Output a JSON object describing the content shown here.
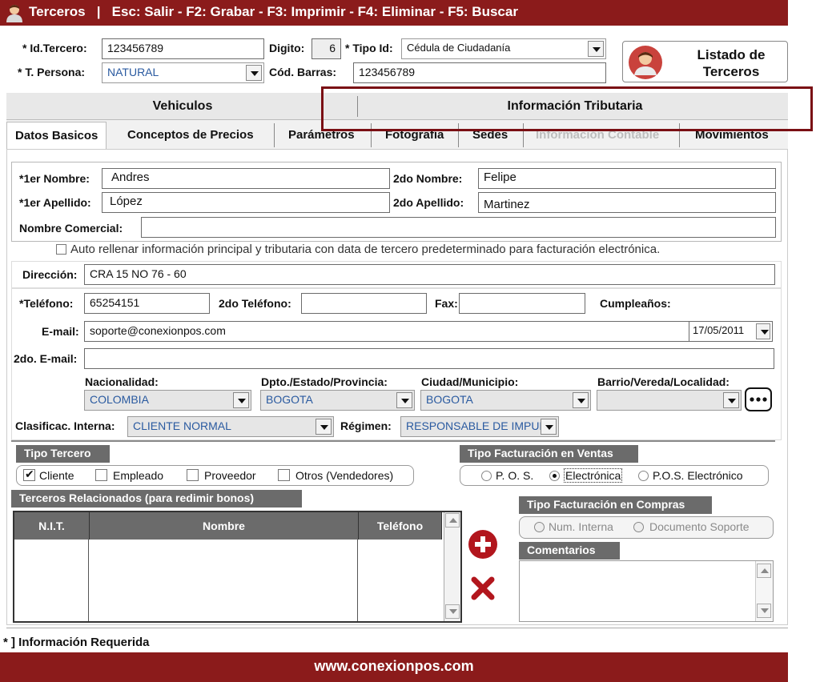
{
  "colors": {
    "brand": "#8b1b1b",
    "highlight": "#7a0f14",
    "section": "#6b6b6b",
    "add": "#b2161d",
    "delete": "#b2161d"
  },
  "titlebar": {
    "icon": "user-icon",
    "text": "Terceros   |   Esc: Salir - F2: Grabar - F3: Imprimir - F4: Eliminar - F5: Buscar"
  },
  "header": {
    "id_tercero_label": "* Id.Tercero:",
    "id_tercero_value": "123456789",
    "digito_label": "Digito:",
    "digito_value": "6",
    "tipo_id_label": "* Tipo Id:",
    "tipo_id_value": "Cédula de Ciudadanía",
    "t_persona_label": "* T. Persona:",
    "t_persona_value": "NATURAL",
    "cod_barras_label": "Cód. Barras:",
    "cod_barras_value": "123456789",
    "listado_line1": "Listado de",
    "listado_line2": "Terceros"
  },
  "tabs_top": [
    "Vehiculos",
    "Información Tributaria"
  ],
  "tabs": [
    {
      "label": "Datos Basicos",
      "active": true
    },
    {
      "label": "Conceptos de Precios"
    },
    {
      "label": "Parámetros"
    },
    {
      "label": "Fotografía"
    },
    {
      "label": "Sedes"
    },
    {
      "label": "Información Contable",
      "disabled": true
    },
    {
      "label": "Movimientos"
    }
  ],
  "names": {
    "primer_nombre_label": "*1er Nombre:",
    "primer_nombre": "Andres",
    "segundo_nombre_label": "2do Nombre:",
    "segundo_nombre": "Felipe",
    "primer_apellido_label": "*1er Apellido:",
    "primer_apellido": "López",
    "segundo_apellido_label": "2do Apellido:",
    "segundo_apellido": "Martinez",
    "nombre_comercial_label": "Nombre Comercial:",
    "nombre_comercial": ""
  },
  "autofill_text": "Auto rellenar información principal y tributaria con data de tercero predeterminado para facturación electrónica.",
  "contact": {
    "direccion_label": "Dirección:",
    "direccion": "CRA 15 NO 76 - 60",
    "telefono_label": "*Teléfono:",
    "telefono": "65254151",
    "telefono2_label": "2do Teléfono:",
    "telefono2": "",
    "fax_label": "Fax:",
    "fax": "",
    "cumple_label": "Cumpleaños:",
    "cumple": "17/05/2011",
    "email_label": "E-mail:",
    "email": "soporte@conexionpos.com",
    "email2_label": "2do. E-mail:",
    "email2": ""
  },
  "location": {
    "nacionalidad_label": "Nacionalidad:",
    "nacionalidad": "COLOMBIA",
    "dpto_label": "Dpto./Estado/Provincia:",
    "dpto": "BOGOTA",
    "ciudad_label": "Ciudad/Municipio:",
    "ciudad": "BOGOTA",
    "barrio_label": "Barrio/Vereda/Localidad:",
    "barrio": "",
    "clasif_label": "Clasificac. Interna:",
    "clasif": "CLIENTE NORMAL",
    "regimen_label": "Régimen:",
    "regimen": "RESPONSABLE DE IMPUE"
  },
  "tipo_tercero": {
    "title": "Tipo Tercero",
    "options": [
      {
        "label": "Cliente",
        "checked": true
      },
      {
        "label": "Empleado",
        "checked": false
      },
      {
        "label": "Proveedor",
        "checked": false
      },
      {
        "label": "Otros (Vendedores)",
        "checked": false
      }
    ]
  },
  "tipo_fact_ventas": {
    "title": "Tipo Facturación en Ventas",
    "options": [
      {
        "label": "P. O. S.",
        "selected": false
      },
      {
        "label": "Electrónica",
        "selected": true
      },
      {
        "label": "P.O.S. Electrónico",
        "selected": false
      }
    ]
  },
  "terceros_relacionados": {
    "title": "Terceros Relacionados (para redimir bonos)",
    "columns": [
      "N.I.T.",
      "Nombre",
      "Teléfono"
    ]
  },
  "tipo_fact_compras": {
    "title": "Tipo Facturación en Compras",
    "options": [
      {
        "label": "Num. Interna",
        "selected": false
      },
      {
        "label": "Documento Soporte",
        "selected": false
      }
    ]
  },
  "comentarios_title": "Comentarios",
  "required_note": "* ] Información Requerida",
  "footer_text": "www.conexionpos.com"
}
